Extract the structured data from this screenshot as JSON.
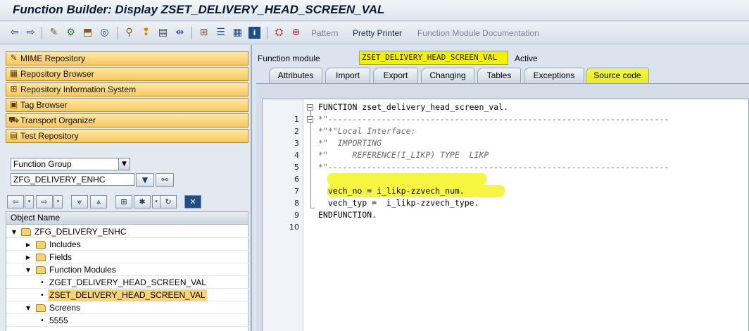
{
  "window": {
    "title": "Function Builder: Display ZSET_DELIVERY_HEAD_SCREEN_VAL"
  },
  "toolbar": {
    "icons": [
      "back-icon",
      "forward-icon",
      "toggle-display-change-icon",
      "activate-icon",
      "check-icon",
      "object-list-icon",
      "where-used-icon",
      "lamp-icon",
      "display-object-list-icon",
      "navigation-icon",
      "hierarchy-icon",
      "stack-icon",
      "list-icon",
      "info-icon",
      "test-icon",
      "function-icon"
    ],
    "pattern_label": "Pattern",
    "pretty_printer_label": "Pretty Printer",
    "fm_documentation_label": "Function Module Documentation"
  },
  "navigation": {
    "buttons": [
      {
        "label": "MIME Repository",
        "icon": "mime-repository-icon"
      },
      {
        "label": "Repository Browser",
        "icon": "repository-browser-icon"
      },
      {
        "label": "Repository Information System",
        "icon": "repository-info-icon"
      },
      {
        "label": "Tag Browser",
        "icon": "tag-browser-icon"
      },
      {
        "label": "Transport Organizer",
        "icon": "transport-organizer-icon"
      },
      {
        "label": "Test Repository",
        "icon": "test-repository-icon"
      }
    ],
    "object_type": "Function Group",
    "object_value": "ZFG_DELIVERY_ENHC"
  },
  "tree": {
    "header": "Object Name",
    "nodes": [
      {
        "label": "ZFG_DELIVERY_ENHC",
        "type": "folder",
        "expanded": true,
        "level": 0
      },
      {
        "label": "Includes",
        "type": "folder",
        "expanded": false,
        "level": 1
      },
      {
        "label": "Fields",
        "type": "folder",
        "expanded": false,
        "level": 1
      },
      {
        "label": "Function Modules",
        "type": "folder",
        "expanded": true,
        "level": 1
      },
      {
        "label": "ZGET_DELIVERY_HEAD_SCREEN_VAL",
        "type": "leaf",
        "level": 2
      },
      {
        "label": "ZSET_DELIVERY_HEAD_SCREEN_VAL",
        "type": "leaf",
        "level": 2,
        "selected": true
      },
      {
        "label": "Screens",
        "type": "folder",
        "expanded": true,
        "level": 1
      },
      {
        "label": "5555",
        "type": "leaf",
        "level": 2
      }
    ]
  },
  "function_module": {
    "label": "Function module",
    "value": "ZSET_DELIVERY_HEAD_SCREEN_VAL",
    "status": "Active"
  },
  "tabs": [
    {
      "label": "Attributes"
    },
    {
      "label": "Import"
    },
    {
      "label": "Export"
    },
    {
      "label": "Changing"
    },
    {
      "label": "Tables"
    },
    {
      "label": "Exceptions"
    },
    {
      "label": "Source code",
      "active": true
    }
  ],
  "source_code": [
    {
      "num": "1",
      "text": "FUNCTION zset_delivery_head_screen_val.",
      "style": "kw"
    },
    {
      "num": "2",
      "text": "*\"----------------------------------------------------------------------",
      "style": "cm"
    },
    {
      "num": "3",
      "text": "*\"*\"Local Interface:",
      "style": "cm"
    },
    {
      "num": "4",
      "text": "*\"  IMPORTING",
      "style": "cm"
    },
    {
      "num": "5",
      "text": "*\"     REFERENCE(I_LIKP) TYPE  LIKP",
      "style": "cm"
    },
    {
      "num": "6",
      "text": "*\"----------------------------------------------------------------------",
      "style": "cm"
    },
    {
      "num": "7",
      "text": "",
      "style": "kw"
    },
    {
      "num": "8",
      "text": "  vech_no = i_likp-zzvech_num.",
      "style": "kw"
    },
    {
      "num": "9",
      "text": "  vech_typ =  i_likp-zzvech_type.",
      "style": "kw"
    },
    {
      "num": "10",
      "text": "ENDFUNCTION.",
      "style": "kw"
    }
  ],
  "colors": {
    "highlight": "#f5f51e",
    "nav_button": "#f7c860",
    "selected_row": "#fbd377"
  }
}
